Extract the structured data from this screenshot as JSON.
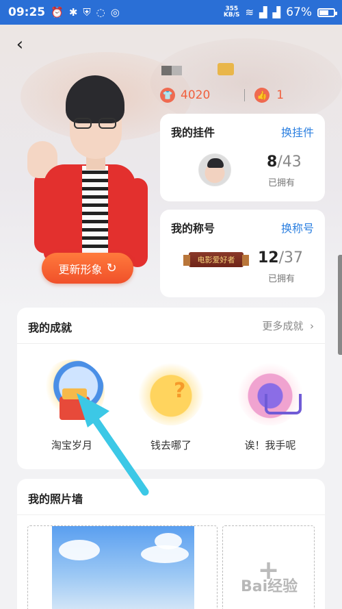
{
  "status_bar": {
    "time": "09:25",
    "net_speed_value": "355",
    "net_speed_unit": "KB/S",
    "battery_percent": "67%",
    "battery_level": 0.67
  },
  "header": {
    "stats": {
      "points": "4020",
      "likes": "1"
    },
    "update_button_label": "更新形象"
  },
  "pendant_card": {
    "title": "我的挂件",
    "link": "换挂件",
    "owned_count": "8",
    "total_count": "/43",
    "owned_label": "已拥有"
  },
  "title_card": {
    "title": "我的称号",
    "link": "换称号",
    "ribbon_text": "电影爱好者",
    "owned_count": "12",
    "total_count": "/37",
    "owned_label": "已拥有"
  },
  "achievements": {
    "title": "我的成就",
    "more_label": "更多成就",
    "items": [
      {
        "label": "淘宝岁月",
        "icon": "clock-gift-icon"
      },
      {
        "label": "钱去哪了",
        "icon": "money-box-icon"
      },
      {
        "label": "诶！我手呢",
        "icon": "shopping-cart-icon"
      }
    ]
  },
  "photo_wall": {
    "title": "我的照片墙"
  },
  "watermark": "Bai经验",
  "colors": {
    "status_bar": "#2a6fd6",
    "accent_orange": "#f0603e",
    "link_blue": "#2b7fe0",
    "arrow_cyan": "#3cc8e6"
  }
}
